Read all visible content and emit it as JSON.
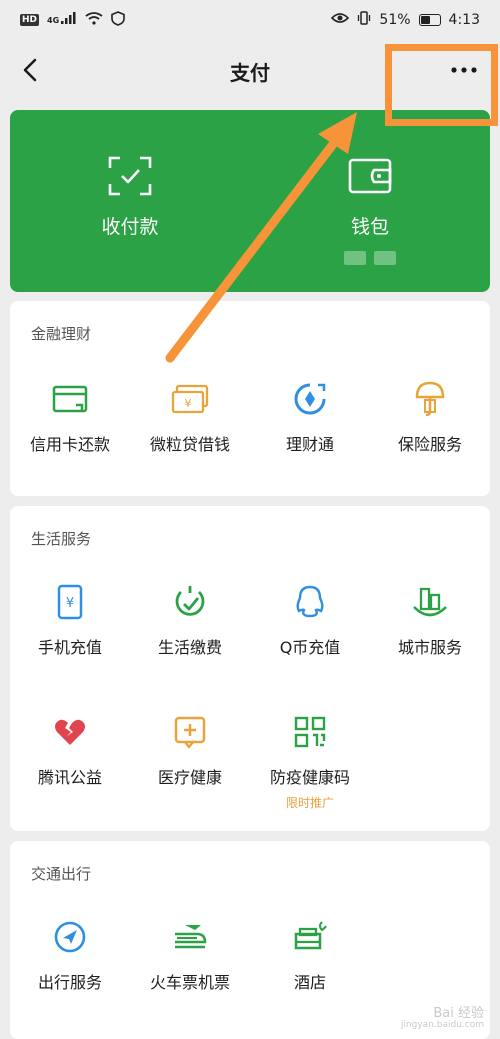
{
  "status_bar": {
    "hd": "HD",
    "network": "4G",
    "battery": "51%",
    "battery_level": 0.51,
    "time": "4:13"
  },
  "nav": {
    "title": "支付"
  },
  "wallet": {
    "receive_label": "收付款",
    "wallet_label": "钱包"
  },
  "sections": {
    "finance": {
      "title": "金融理财",
      "items": [
        {
          "label": "信用卡还款",
          "icon": "credit-card-icon",
          "color": "#2ba245"
        },
        {
          "label": "微粒贷借钱",
          "icon": "loan-icon",
          "color": "#e8a33b"
        },
        {
          "label": "理财通",
          "icon": "wealth-icon",
          "color": "#2f8fe0"
        },
        {
          "label": "保险服务",
          "icon": "insurance-icon",
          "color": "#e8a33b"
        }
      ]
    },
    "life": {
      "title": "生活服务",
      "items": [
        {
          "label": "手机充值",
          "icon": "phone-recharge-icon",
          "color": "#2f8fe0"
        },
        {
          "label": "生活缴费",
          "icon": "utilities-icon",
          "color": "#2ba245"
        },
        {
          "label": "Q币充值",
          "icon": "qq-coin-icon",
          "color": "#2f8fe0"
        },
        {
          "label": "城市服务",
          "icon": "city-icon",
          "color": "#2ba245"
        },
        {
          "label": "腾讯公益",
          "icon": "charity-icon",
          "color": "#e0454f"
        },
        {
          "label": "医疗健康",
          "icon": "medical-icon",
          "color": "#e8a33b"
        },
        {
          "label": "防疫健康码",
          "icon": "qr-code-icon",
          "color": "#2ba245",
          "sub": "限时推广"
        }
      ]
    },
    "transport": {
      "title": "交通出行",
      "items": [
        {
          "label": "出行服务",
          "icon": "navigation-icon",
          "color": "#2f8fe0"
        },
        {
          "label": "火车票机票",
          "icon": "train-icon",
          "color": "#2ba245"
        },
        {
          "label": "酒店",
          "icon": "hotel-icon",
          "color": "#2ba245"
        }
      ]
    }
  },
  "watermark": {
    "text": "Bai 经验",
    "sub": "jingyan.baidu.com"
  },
  "colors": {
    "accent_green": "#2ba245",
    "highlight_orange": "#f7943a"
  }
}
